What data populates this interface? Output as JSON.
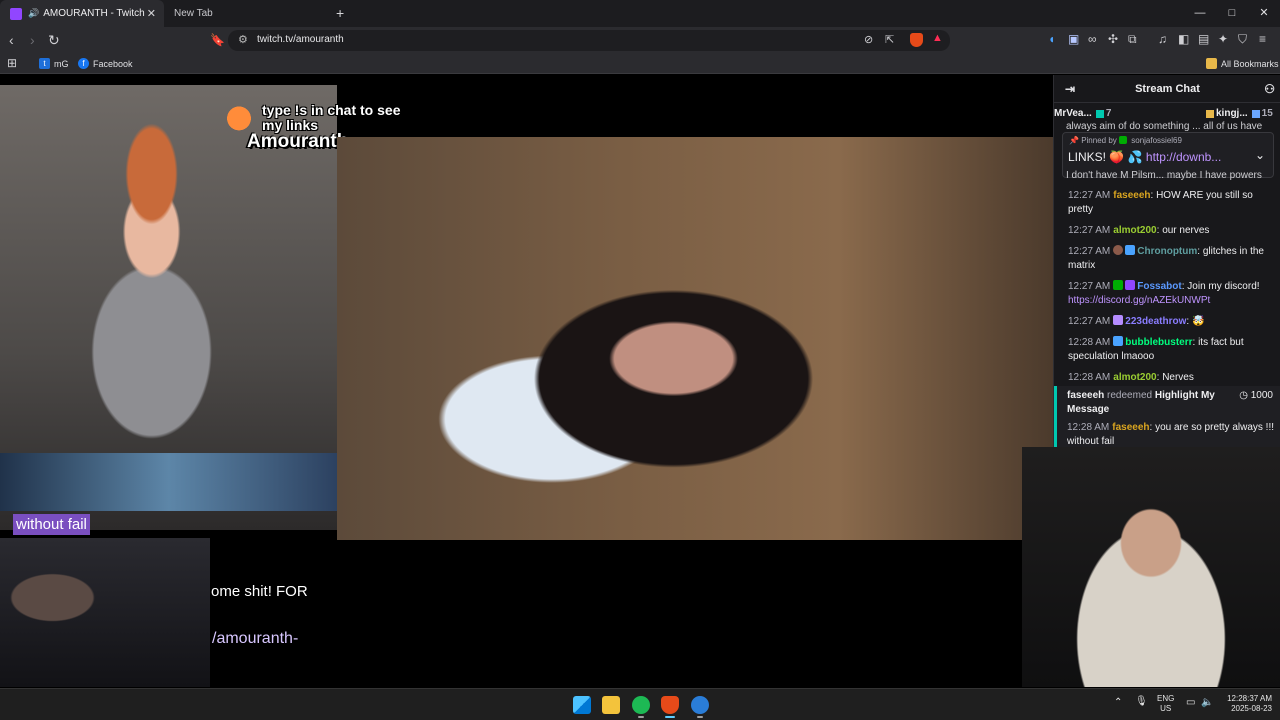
{
  "browser": {
    "tabs": [
      {
        "title": "AMOURANTH - Twitch",
        "active": true
      },
      {
        "title": "New Tab",
        "active": false
      }
    ],
    "new_tab_glyph": "+",
    "close_glyph": "✕",
    "window_controls": {
      "minimize": "—",
      "maximize": "□",
      "close": "✕"
    },
    "url": "twitch.tv/amouranth",
    "bookmarks": [
      {
        "label": "mG",
        "icon": "mg-icon"
      },
      {
        "label": "Facebook",
        "icon": "facebook-icon"
      }
    ],
    "all_bookmarks": "All Bookmarks",
    "brave_rewards_glyph": "▲"
  },
  "stream": {
    "overlay_line": "type !s in chat to see my links",
    "overlay_name": "Amouranth",
    "caption_chip": "without fail",
    "partial_text": "ome shit! FOR",
    "partial_link": "/amouranth-"
  },
  "chat": {
    "title": "Stream Chat",
    "gifters": [
      {
        "name": "MrVea...",
        "count": "7",
        "color": "#ffd37a"
      },
      {
        "name": "kingj...",
        "count": "15",
        "color": "#ffd37a"
      }
    ],
    "cut_line_top": "always aim of do something ... all of us have",
    "pinned": {
      "by_label": "Pinned by",
      "by_user": "sonjafossiel69",
      "text": "LINKS!",
      "link": "http://downb..."
    },
    "cut_line_bottom": "I don't have M Pilsm... maybe I have powers",
    "messages": [
      {
        "time": "12:27 AM",
        "user": "faseeeh",
        "color": "#daa520",
        "text": "HOW ARE you still so pretty"
      },
      {
        "time": "12:27 AM",
        "user": "almot200",
        "color": "#9acd32",
        "text": "our nerves"
      },
      {
        "time": "12:27 AM",
        "user": "Chronoptum",
        "color": "#5f9ea0",
        "text": "glitches in the matrix"
      },
      {
        "time": "12:27 AM",
        "user": "Fossabot",
        "color": "#5b99ff",
        "text": "Join my discord!",
        "link": "https://discord.gg/nAZEkUNWPt"
      },
      {
        "time": "12:27 AM",
        "user": "223deathrow",
        "color": "#8a7dff",
        "text": "🤯"
      },
      {
        "time": "12:28 AM",
        "user": "bubblebusterr",
        "color": "#00ff7f",
        "text": "its fact but speculation lmaooo"
      },
      {
        "time": "12:28 AM",
        "user": "almot200",
        "color": "#9acd32",
        "text": "Nerves"
      }
    ],
    "redemption": {
      "user": "faseeeh",
      "verb": "redeemed",
      "reward": "Highlight My Message",
      "cost": "1000",
      "time": "12:28 AM",
      "msg_user": "faseeeh",
      "text": "you are so pretty always !!! without fail"
    }
  },
  "taskbar": {
    "lang_top": "ENG",
    "lang_bottom": "US",
    "time": "12:28:37 AM",
    "date": "2025-08-23"
  }
}
